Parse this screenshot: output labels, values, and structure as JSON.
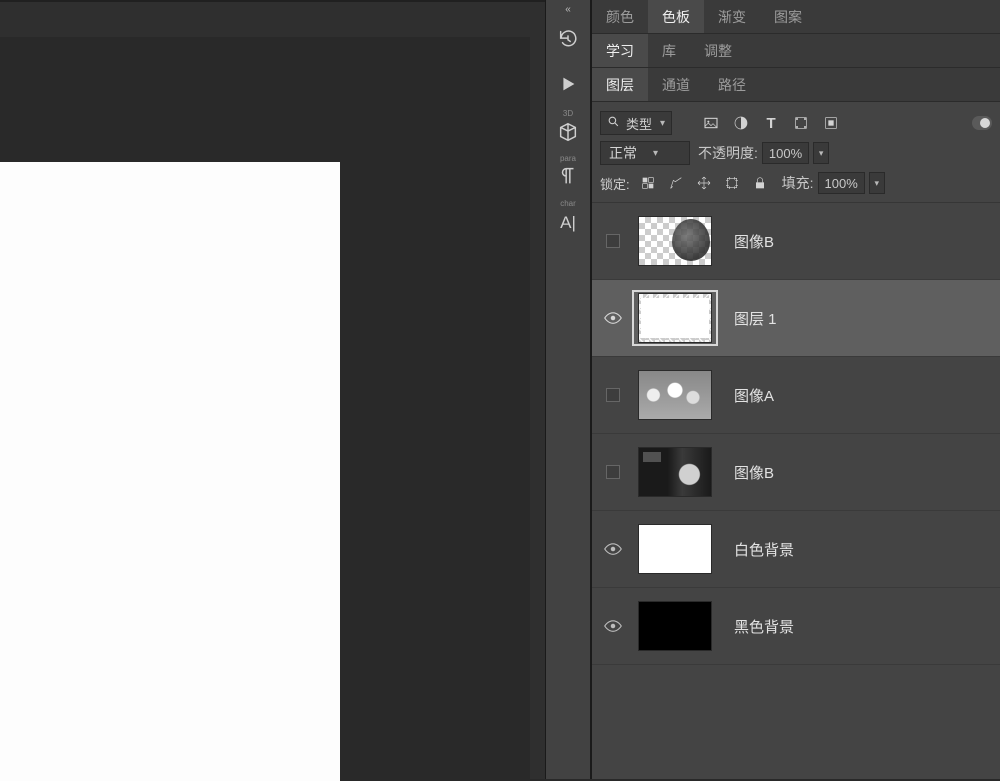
{
  "toolstrip": {
    "tools": [
      {
        "name": "history-brush-icon"
      },
      {
        "name": "play-icon"
      },
      {
        "name": "3d-icon"
      },
      {
        "name": "paragraph-icon"
      },
      {
        "name": "character-icon",
        "label": "A|"
      }
    ]
  },
  "panel_tabs_1": {
    "color": "颜色",
    "swatches": "色板",
    "gradient": "渐变",
    "pattern": "图案",
    "active": "swatches"
  },
  "panel_tabs_2": {
    "learn": "学习",
    "libraries": "库",
    "adjustments": "调整",
    "active": "learn"
  },
  "panel_tabs_3": {
    "layers": "图层",
    "channels": "通道",
    "paths": "路径",
    "active": "layers"
  },
  "layers_panel": {
    "filter_label": "类型",
    "blend_mode": "正常",
    "opacity_label": "不透明度:",
    "opacity_value": "100%",
    "lock_label": "锁定:",
    "fill_label": "填充:",
    "fill_value": "100%"
  },
  "layers": [
    {
      "name": "图像B",
      "visible": false,
      "selected": false,
      "thumb": "checker-face"
    },
    {
      "name": "图层 1",
      "visible": true,
      "selected": true,
      "thumb": "checker"
    },
    {
      "name": "图像A",
      "visible": false,
      "selected": false,
      "thumb": "flowers"
    },
    {
      "name": "图像B",
      "visible": false,
      "selected": false,
      "thumb": "dark-art"
    },
    {
      "name": "白色背景",
      "visible": true,
      "selected": false,
      "thumb": "white"
    },
    {
      "name": "黑色背景",
      "visible": true,
      "selected": false,
      "thumb": "black"
    }
  ]
}
